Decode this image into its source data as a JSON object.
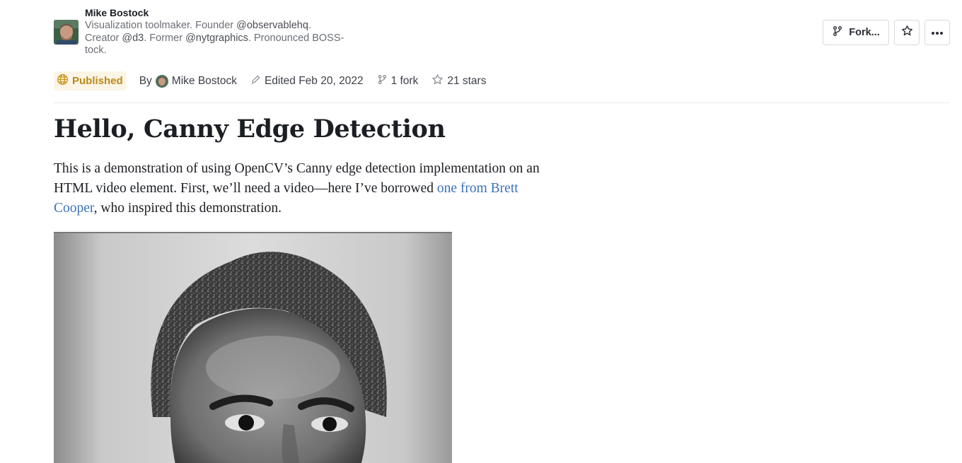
{
  "author": {
    "name": "Mike Bostock",
    "bio": {
      "part1": "Visualization toolmaker. Founder ",
      "handle1": "@observablehq",
      "part2": ". Creator ",
      "handle2": "@d3",
      "part3": ". Former ",
      "handle3": "@nytgraphics",
      "part4": ". Pronounced BOSS-tock."
    }
  },
  "actions": {
    "fork_label": "Fork...",
    "star_icon": "star-icon",
    "more_icon": "more-horizontal-icon"
  },
  "meta": {
    "status": "Published",
    "by_label": "By",
    "by_name": "Mike Bostock",
    "edited": "Edited Feb 20, 2022",
    "forks": "1 fork",
    "stars": "21 stars"
  },
  "notebook": {
    "title": "Hello, Canny Edge Detection",
    "intro": {
      "text1": "This is a demonstration of using OpenCV’s Canny edge detection implementation on an HTML video element. First, we’ll need a video—here I’ve borrowed ",
      "link": "one from Brett Cooper",
      "text2": ", who inspired this demonstration."
    }
  },
  "colors": {
    "accent_link": "#3b72b8",
    "published_badge_bg": "#fbf5e7",
    "published_badge_text": "#b88a1c"
  }
}
